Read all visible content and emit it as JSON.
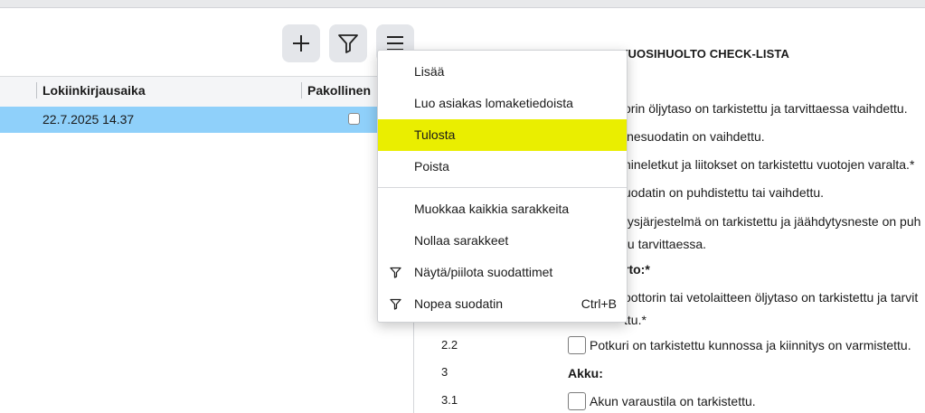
{
  "toolbar": {
    "add_icon": "plus-icon",
    "filter_icon": "filter-icon",
    "menu_icon": "hamburger-menu-icon"
  },
  "grid": {
    "columns": [
      "Lokiinkirjausaika",
      "Pakollinen"
    ],
    "rows": [
      {
        "timestamp": "22.7.2025 14.37",
        "required": false,
        "selected": true
      }
    ],
    "selected_row_color": "#8fd0fa"
  },
  "document": {
    "title": "VENEEN VUOSIHUOLTO CHECK-LISTA",
    "lines": [
      "orin öljytaso on tarkistettu ja tarvittaessa vaihdettu.",
      "inesuodatin on vaihdettu.",
      "nineletkut ja liitokset on tarkistettu vuotojen varalta.*",
      "uodatin on puhdistettu tai vaihdettu.",
      "tysjärjestelmä on tarkistettu ja jäähdytysneste on puh",
      "tu tarvittaessa.",
      "rto:*",
      "oottorin tai vetolaitteen öljytaso on tarkistettu ja tarvit",
      "ttu.*"
    ],
    "items": [
      {
        "number": "2.2",
        "text": "Potkuri on tarkistettu kunnossa ja kiinnitys on varmistettu.",
        "checked": false
      },
      {
        "number": "3",
        "text": "Akku:",
        "heading": true
      },
      {
        "number": "3.1",
        "text": "Akun varaustila on tarkistettu.",
        "checked": false
      }
    ]
  },
  "menu": {
    "items": [
      {
        "label": "Lisää"
      },
      {
        "label": "Luo asiakas lomaketiedoista"
      },
      {
        "label": "Tulosta",
        "highlighted": true
      },
      {
        "label": "Poista"
      },
      {
        "label": "Muokkaa kaikkia sarakkeita"
      },
      {
        "label": "Nollaa sarakkeet"
      },
      {
        "label": "Näytä/piilota suodattimet",
        "icon": "filter-icon"
      },
      {
        "label": "Nopea suodatin",
        "icon": "filter-icon",
        "shortcut": "Ctrl+B"
      }
    ],
    "highlight_color": "#eaee00"
  }
}
